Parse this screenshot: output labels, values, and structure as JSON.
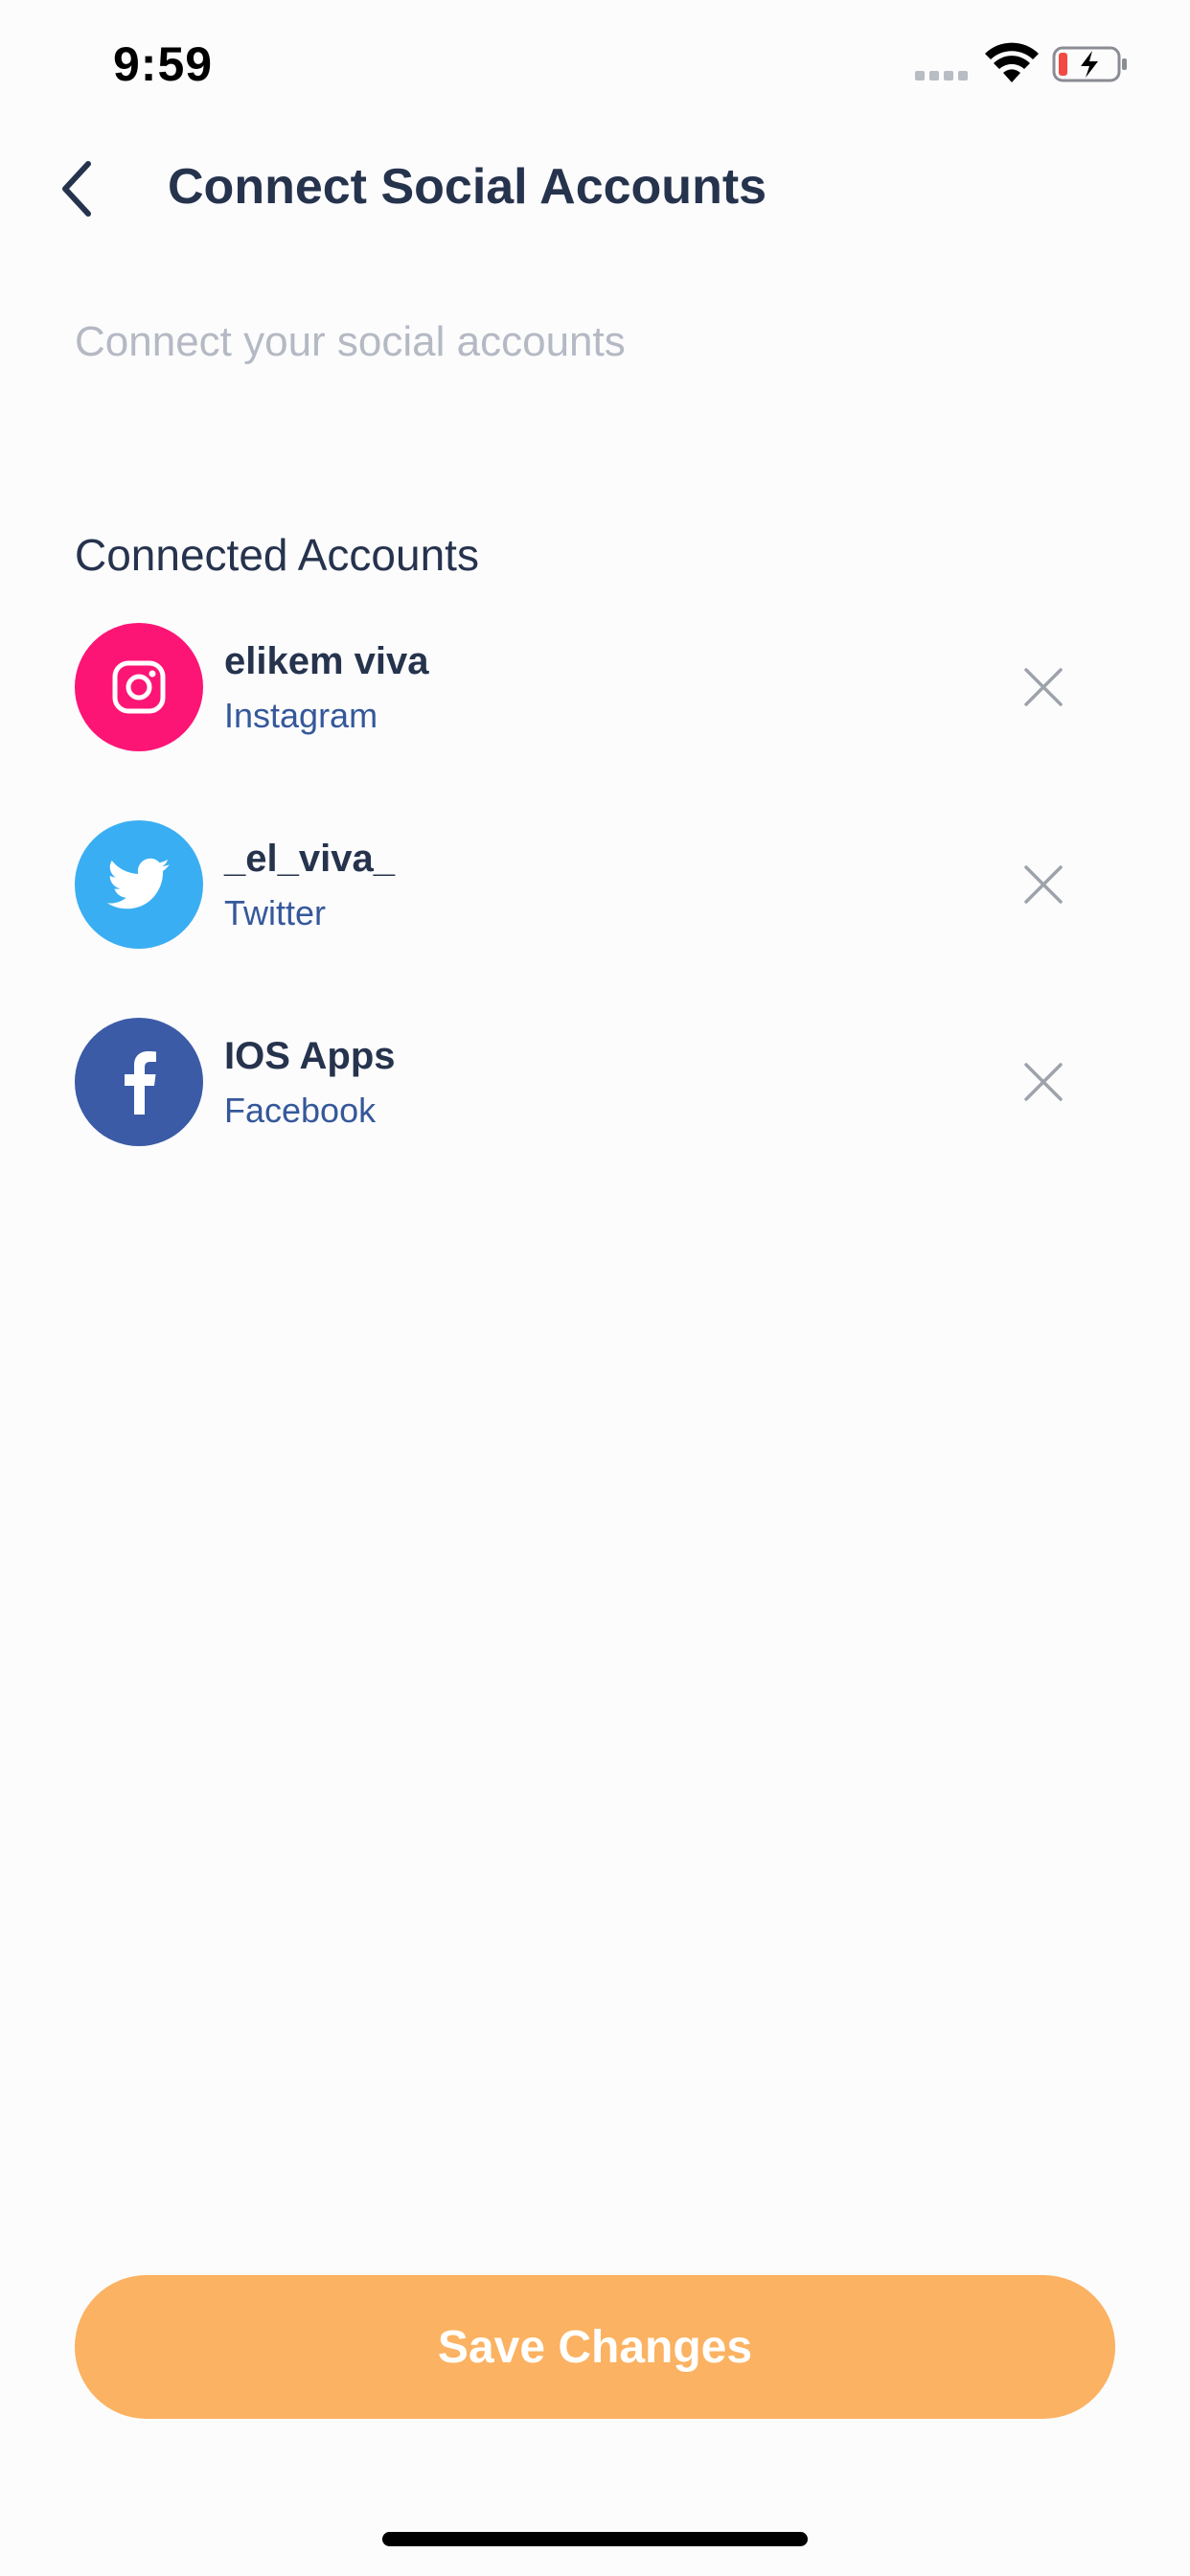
{
  "status_bar": {
    "time": "9:59",
    "battery_level": 0.1,
    "charging": true
  },
  "header": {
    "title": "Connect Social Accounts",
    "back_icon": "chevron-left-icon"
  },
  "subtitle": "Connect your social accounts",
  "section_title": "Connected Accounts",
  "accounts": [
    {
      "name": "elikem viva",
      "platform": "Instagram",
      "icon": "instagram-icon",
      "color": "#fd1576"
    },
    {
      "name": "_el_viva_",
      "platform": "Twitter",
      "icon": "twitter-icon",
      "color": "#3aaef2"
    },
    {
      "name": "IOS Apps",
      "platform": "Facebook",
      "icon": "facebook-icon",
      "color": "#3b5ba6"
    }
  ],
  "save_button": {
    "label": "Save Changes",
    "color": "#fbb262"
  },
  "colors": {
    "text_primary": "#26334d",
    "text_muted": "#b4b9c3",
    "link": "#35589a",
    "remove_icon": "#9ea3ab"
  }
}
